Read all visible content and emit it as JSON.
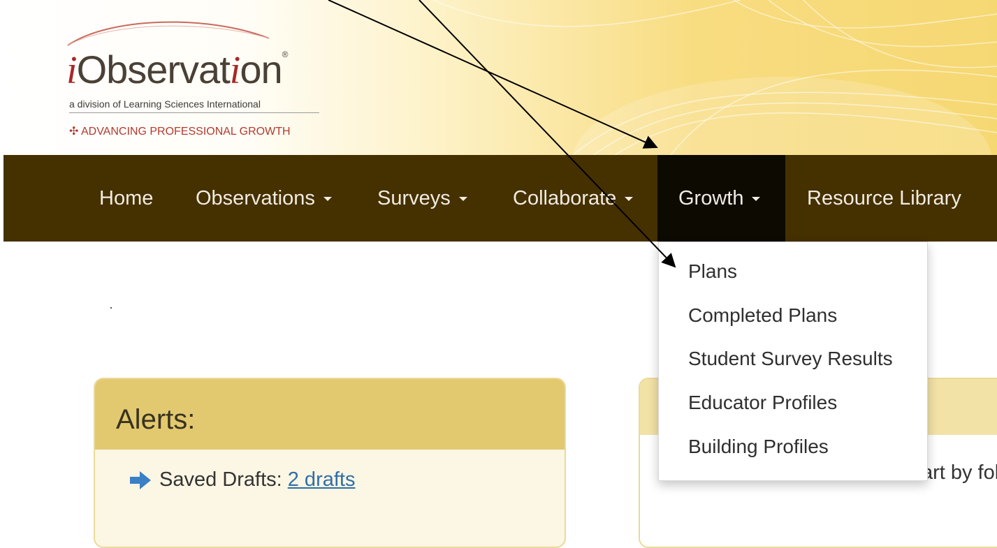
{
  "logo": {
    "name_i_first": "i",
    "name_mid": "Observat",
    "name_i_second": "i",
    "name_end": "on",
    "registered": "®",
    "subtitle": "a division of Learning Sciences International",
    "tagline_icon": "✣",
    "tagline": "ADVANCING PROFESSIONAL GROWTH"
  },
  "nav": {
    "items": [
      {
        "label": "Home"
      },
      {
        "label": "Observations"
      },
      {
        "label": "Surveys"
      },
      {
        "label": "Collaborate"
      },
      {
        "label": "Growth"
      },
      {
        "label": "Resource Library"
      }
    ]
  },
  "dropdown": {
    "items": [
      {
        "label": "Plans"
      },
      {
        "label": "Completed Plans"
      },
      {
        "label": "Student Survey Results"
      },
      {
        "label": "Educator Profiles"
      },
      {
        "label": "Building Profiles"
      }
    ]
  },
  "alerts": {
    "title": "Alerts:",
    "label": "Saved Drafts: ",
    "link": "2 drafts"
  },
  "welcome": {
    "text": "Welcome to iObservation. Start by fol"
  },
  "colors": {
    "nav_bg": "#453000",
    "nav_active": "#0d0a02",
    "panel_header": "#e2c96f",
    "panel_body": "#fcf6e4",
    "link": "#2f6fa8",
    "brand_red": "#a8282a"
  }
}
